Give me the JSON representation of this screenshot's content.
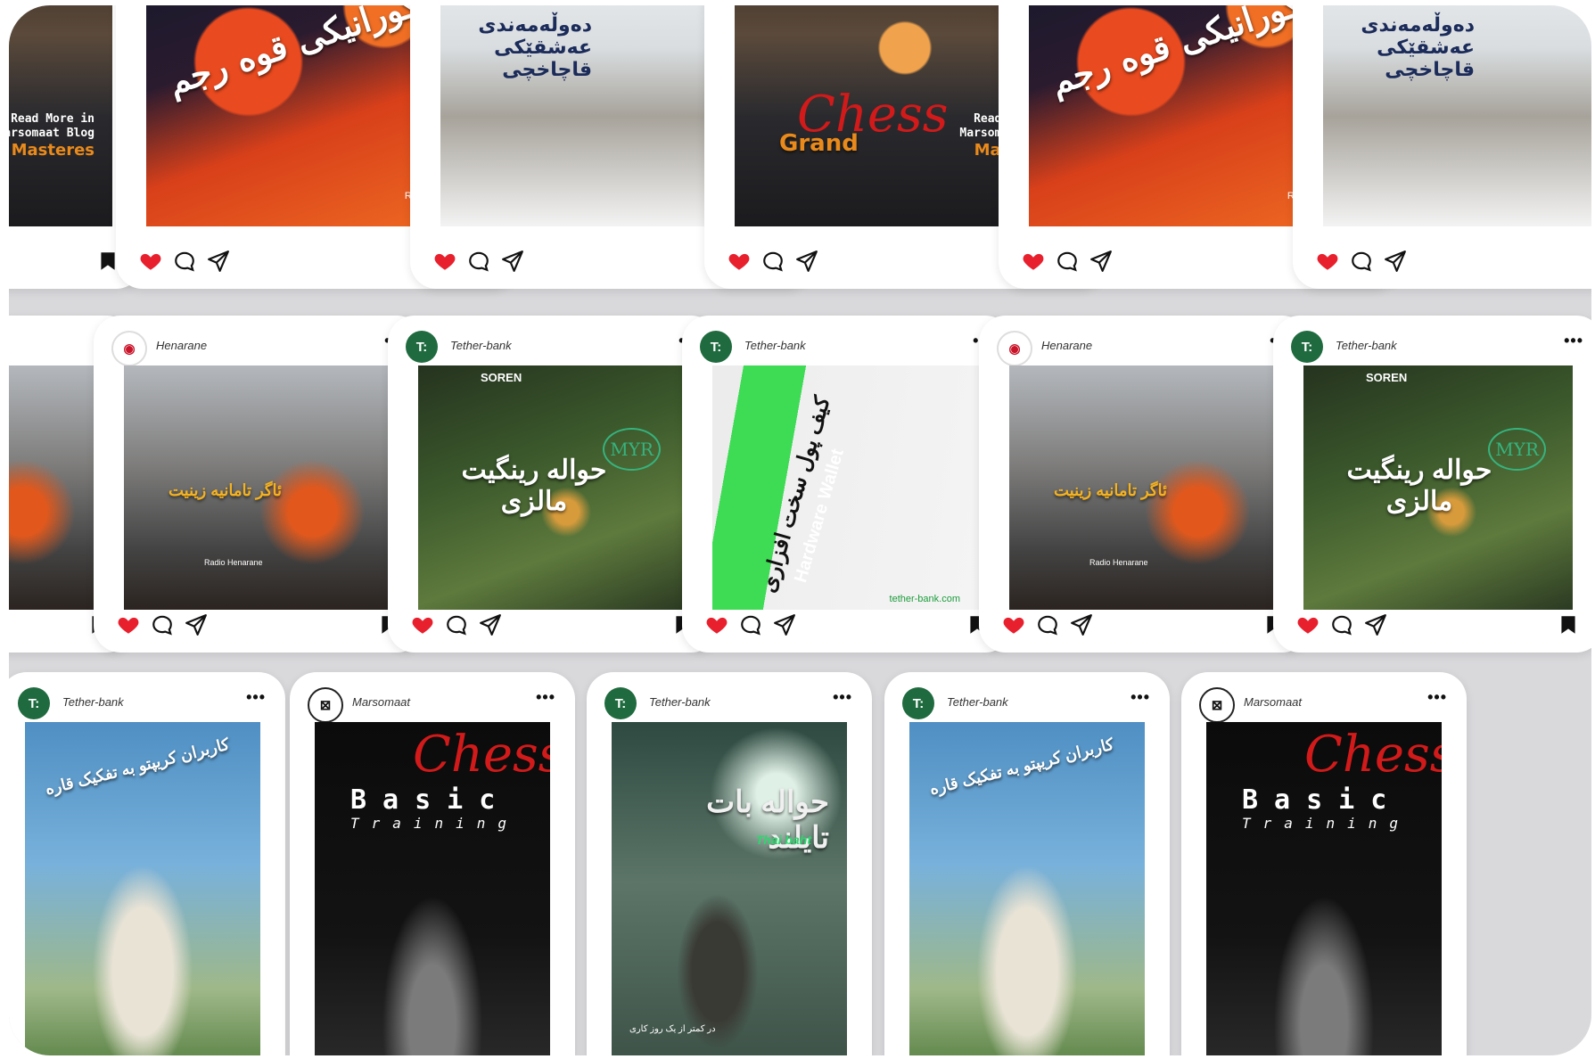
{
  "header_labels": {
    "henarane": "Henarane",
    "tether": "Tether-bank",
    "marsomaat": "Marsomaat"
  },
  "colors": {
    "stage_bg": "#d9d9dc",
    "like_red": "#e8202e",
    "tether_green": "#1f6b3f",
    "henarane_red": "#c9152a",
    "chess_red": "#d21a1a"
  },
  "texts": {
    "tag_recruit": "مَن گورانیکی قوه رجم",
    "tag_snow": "دەوڵەمەندی عەشقێکی قاچاخچی",
    "tag_fire": "ئاگر تامانیه‌ زینیت",
    "tag_hawala_my": "حواله رینگیت مالزی",
    "tag_wallet": "کیف پول سخت افزاری",
    "tag_wallet_en": "Hardware Wallet",
    "tag_wallet_site": "tether-bank.com",
    "tag_taj": "کاربران کریپتو به تفکیک قاره",
    "tag_thai": "حواله بات تایلند",
    "tag_thai_sub": "Thai baht",
    "tag_thai_small": "در کمتر از یک روز کاری",
    "chess_grand": "Grand",
    "chess_word": "Chess",
    "chess_masters": "Masteres",
    "chess_readmore": "Read More in",
    "chess_blog": "Marsomaat Blog",
    "chess_basic": "Basic",
    "chess_training": "Training",
    "soren": "SOREN",
    "myr": "MYR",
    "radio": "Radio Henarane"
  },
  "icons": {
    "like": "heart-icon",
    "comment": "comment-icon",
    "share": "share-icon",
    "save": "bookmark-icon",
    "more": "more-icon"
  }
}
